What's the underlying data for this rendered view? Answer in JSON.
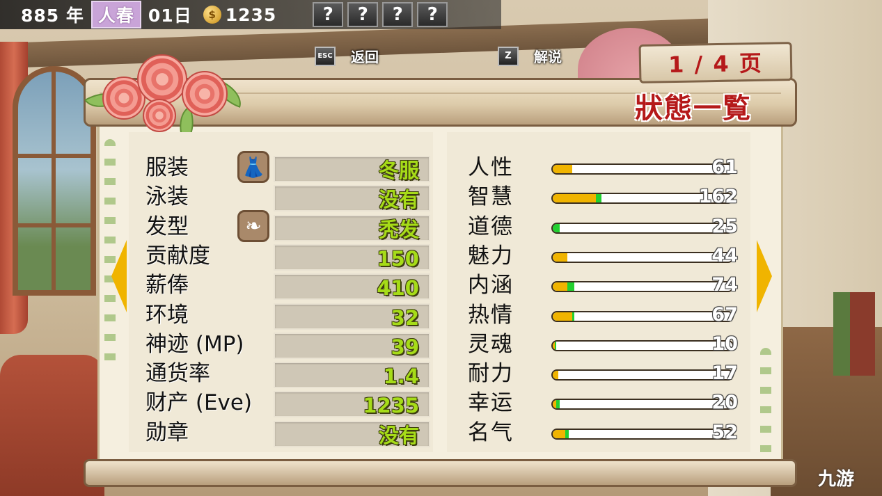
{
  "hud": {
    "year": "885 年",
    "season": "人春",
    "day": "01日",
    "gold": "1235",
    "slots": [
      "?",
      "?",
      "?",
      "?"
    ]
  },
  "hints": {
    "back_key": "ESC",
    "back_label": "返回",
    "explain_key": "Z",
    "explain_label": "解说"
  },
  "page_indicator": "1 / 4 页",
  "title": "狀態一覧",
  "left_stats": [
    {
      "label": "服装",
      "value": "冬服",
      "icon": "dress-icon"
    },
    {
      "label": "泳装",
      "value": "没有",
      "icon": null
    },
    {
      "label": "发型",
      "value": "秃发",
      "icon": "hair-icon"
    },
    {
      "label": "贡献度",
      "value": "150",
      "icon": null
    },
    {
      "label": "薪俸",
      "value": "410",
      "icon": null
    },
    {
      "label": "环境",
      "value": "32",
      "icon": null
    },
    {
      "label": "神迹 (MP)",
      "value": "39",
      "icon": null
    },
    {
      "label": "通货率",
      "value": "1.4",
      "icon": null
    },
    {
      "label": "财产 (Eve)",
      "value": "1235",
      "icon": null
    },
    {
      "label": "勋章",
      "value": "没有",
      "icon": null
    }
  ],
  "right_stats": [
    {
      "label": "人性",
      "value": "61",
      "fill_pct": 11,
      "green_pct": 0
    },
    {
      "label": "智慧",
      "value": "162",
      "fill_pct": 24,
      "green_pct": 3
    },
    {
      "label": "道德",
      "value": "25",
      "fill_pct": 0,
      "green_pct": 4
    },
    {
      "label": "魅力",
      "value": "44",
      "fill_pct": 8,
      "green_pct": 0
    },
    {
      "label": "内涵",
      "value": "74",
      "fill_pct": 8,
      "green_pct": 4
    },
    {
      "label": "热情",
      "value": "67",
      "fill_pct": 11,
      "green_pct": 1
    },
    {
      "label": "灵魂",
      "value": "10",
      "fill_pct": 1,
      "green_pct": 1
    },
    {
      "label": "耐力",
      "value": "17",
      "fill_pct": 3,
      "green_pct": 0
    },
    {
      "label": "幸运",
      "value": "20",
      "fill_pct": 2,
      "green_pct": 2
    },
    {
      "label": "名气",
      "value": "52",
      "fill_pct": 7,
      "green_pct": 2
    }
  ],
  "watermark": "九游",
  "colors": {
    "title_red": "#b5191a",
    "value_green": "#a6dc18",
    "bar_yellow": "#f0b400",
    "bar_green": "#22d030"
  }
}
